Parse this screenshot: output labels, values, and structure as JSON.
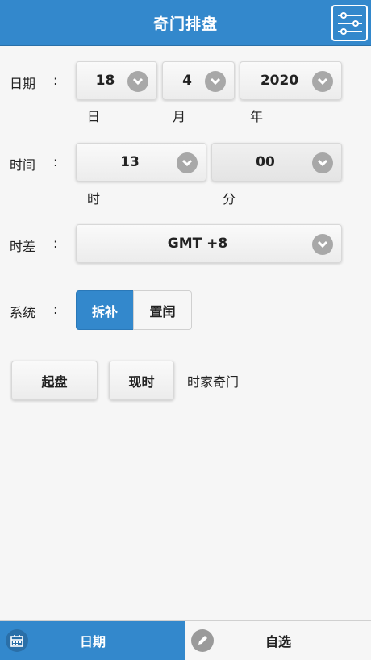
{
  "header": {
    "title": "奇门排盘",
    "menu_icon": "sliders-icon"
  },
  "date_row": {
    "label": "日期",
    "colon": ":",
    "day": "18",
    "day_unit": "日",
    "month": "4",
    "month_unit": "月",
    "year": "2020",
    "year_unit": "年"
  },
  "time_row": {
    "label": "时间",
    "colon": ":",
    "hour": "13",
    "hour_unit": "时",
    "minute": "00",
    "minute_unit": "分"
  },
  "tz_row": {
    "label": "时差",
    "colon": ":",
    "value": "GMT +8"
  },
  "system_row": {
    "label": "系统",
    "colon": ":",
    "options": [
      "拆补",
      "置闰"
    ],
    "selected": "拆补"
  },
  "actions": {
    "start_label": "起盘",
    "now_label": "现时",
    "mode_text": "时家奇门"
  },
  "footer": {
    "tabs": [
      {
        "label": "日期",
        "icon": "calendar-icon",
        "active": true
      },
      {
        "label": "自选",
        "icon": "pencil-icon",
        "active": false
      }
    ]
  },
  "colors": {
    "accent": "#3388cc",
    "background": "#f6f6f6",
    "chevron": "#a8a8a8"
  }
}
